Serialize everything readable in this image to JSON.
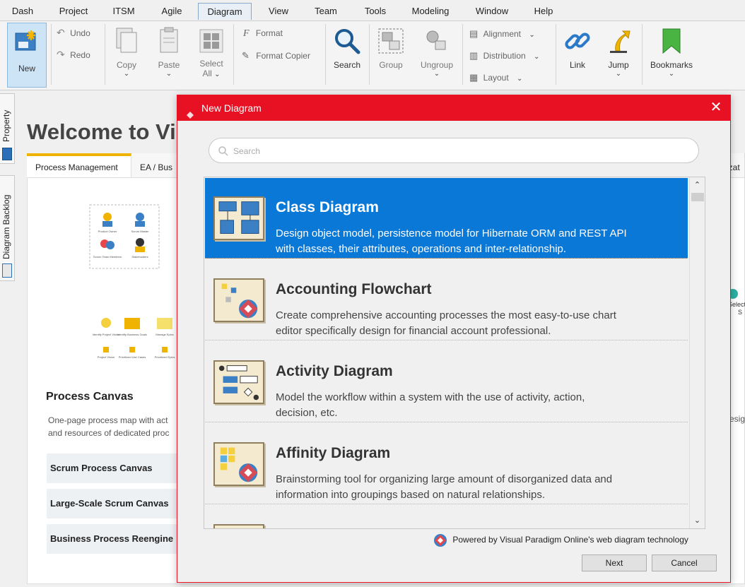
{
  "menubar": {
    "items": [
      "Dash",
      "Project",
      "ITSM",
      "Agile",
      "Diagram",
      "View",
      "Team",
      "Tools",
      "Modeling",
      "Window",
      "Help"
    ],
    "active": "Diagram"
  },
  "toolbar": {
    "new": "New",
    "undo": "Undo",
    "redo": "Redo",
    "copy": "Copy",
    "paste": "Paste",
    "select_all_1": "Select",
    "select_all_2": "All",
    "format": "Format",
    "format_copier": "Format Copier",
    "search": "Search",
    "group": "Group",
    "ungroup": "Ungroup",
    "alignment": "Alignment",
    "distribution": "Distribution",
    "layout": "Layout",
    "link": "Link",
    "jump": "Jump",
    "bookmarks": "Bookmarks",
    "chevron": "⌄"
  },
  "side_tabs": {
    "property": "Property",
    "diagram_backlog": "Diagram Backlog"
  },
  "welcome": {
    "title": "Welcome to Vi",
    "tabs": [
      "Process Management",
      "EA / Bus"
    ],
    "right_tab_fragment": "izat",
    "canvas_title": "Process Canvas",
    "canvas_desc_1": "One-page process map with act",
    "canvas_desc_2": "and resources of dedicated proc",
    "rows": [
      "Scrum Process Canvas",
      "Large-Scale Scrum Canvas",
      "Business Process Reengine"
    ],
    "right_label_1": "Select",
    "right_label_2": "S",
    "right_desc": "esig",
    "thumb_labels": {
      "product_owner": "Product Owner",
      "scrum_master": "Scrum Master",
      "scrum_team": "Scrum Team Members",
      "stakeholders": "Stakeholders",
      "identify_vision": "Identify Project Vision",
      "identify_goals": "Identify Business Goals",
      "manage_epics": "Manage Epics",
      "project_vision": "Project Vision",
      "prioritized_use_cases": "Prioritized Use Cases",
      "prioritized_epics": "Prioritized Epics"
    }
  },
  "dialog": {
    "title": "New Diagram",
    "close": "✕",
    "search_placeholder": "Search",
    "items": [
      {
        "name": "Class Diagram",
        "desc_1": "Design object model, persistence model for Hibernate ORM and REST API",
        "desc_2": "with classes, their attributes, operations and inter-relationship."
      },
      {
        "name": "Accounting Flowchart",
        "desc_1": "Create comprehensive accounting processes the most easy-to-use chart",
        "desc_2": "editor specifically design for financial account professional."
      },
      {
        "name": "Activity Diagram",
        "desc_1": "Model the workflow within a system with the use of activity, action,",
        "desc_2": "decision, etc."
      },
      {
        "name": "Affinity Diagram",
        "desc_1": "Brainstorming tool for organizing large amount of disorganized data and",
        "desc_2": "information into groupings based on natural relationships."
      }
    ],
    "powered_by": "Powered by Visual Paradigm Online's web diagram technology",
    "next": "Next",
    "cancel": "Cancel",
    "scroll_up": "⌃",
    "scroll_down": "⌄"
  },
  "colors": {
    "dialog_accent": "#e81123",
    "selection": "#0a78d7",
    "tab_highlight": "#f0b400"
  }
}
